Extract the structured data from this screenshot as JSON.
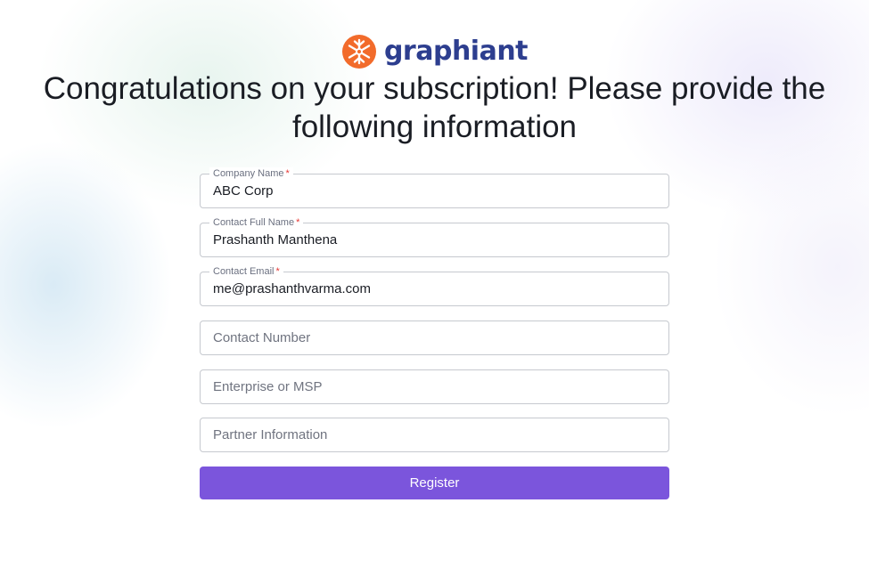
{
  "brand": {
    "name": "graphiant",
    "logo_icon": "graphiant-logo-icon",
    "color": "#2d3e8f",
    "icon_color": "#f26b2b"
  },
  "headline": "Congratulations on your subscription! Please provide the following information",
  "form": {
    "company_name": {
      "label": "Company Name",
      "required_mark": "*",
      "value": "ABC Corp"
    },
    "contact_full_name": {
      "label": "Contact Full Name",
      "required_mark": "*",
      "value": "Prashanth Manthena"
    },
    "contact_email": {
      "label": "Contact Email",
      "required_mark": "*",
      "value": "me@prashanthvarma.com"
    },
    "contact_number": {
      "placeholder": "Contact Number",
      "value": ""
    },
    "enterprise_or_msp": {
      "placeholder": "Enterprise or MSP",
      "value": ""
    },
    "partner_information": {
      "placeholder": "Partner Information",
      "value": ""
    },
    "submit_label": "Register",
    "accent_color": "#7b55dc"
  }
}
